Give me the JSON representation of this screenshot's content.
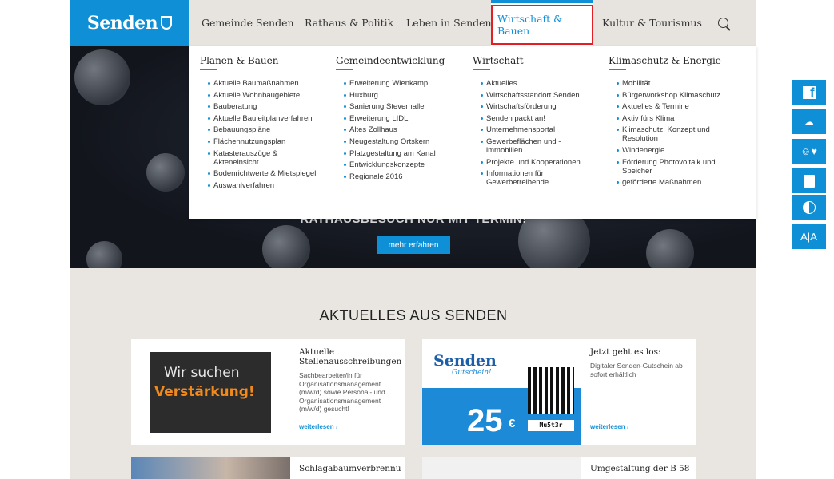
{
  "logo": {
    "text": "Senden"
  },
  "nav": {
    "items": [
      "Gemeinde Senden",
      "Rathaus & Politik",
      "Leben in Senden",
      "Wirtschaft & Bauen",
      "Kultur & Tourismus"
    ]
  },
  "hero": {
    "title": "RATHAUSBESUCH NUR MIT TERMIN!",
    "button": "mehr erfahren"
  },
  "mega": {
    "columns": [
      {
        "title": "Planen & Bauen",
        "items": [
          "Aktuelle Baumaßnahmen",
          "Aktuelle Wohnbaugebiete",
          "Bauberatung",
          "Aktuelle Bauleitplanverfahren",
          "Bebauungspläne",
          "Flächennutzungsplan",
          "Katasterauszüge & Akteneinsicht",
          "Bodenrichtwerte & Mietspiegel",
          "Auswahlverfahren"
        ]
      },
      {
        "title": "Gemeindeentwicklung",
        "items": [
          "Erweiterung Wienkamp",
          "Huxburg",
          "Sanierung Steverhalle",
          "Erweiterung LIDL",
          "Altes Zollhaus",
          "Neugestaltung Ortskern",
          "Platzgestaltung am Kanal",
          "Entwicklungskonzepte",
          "Regionale 2016"
        ]
      },
      {
        "title": "Wirtschaft",
        "items": [
          "Aktuelles",
          "Wirtschaftsstandort Senden",
          "Wirtschaftsförderung",
          "Senden packt an!",
          "Unternehmensportal",
          "Gewerbeflächen und -immobilien",
          "Projekte und Kooperationen",
          "Informationen für Gewerbetreibende"
        ]
      },
      {
        "title": "Klimaschutz & Energie",
        "items": [
          "Mobilität",
          "Bürgerworkshop Klimaschutz",
          "Aktuelles & Termine",
          "Aktiv fürs Klima",
          "Klimaschutz: Konzept und Resolution",
          "Windenergie",
          "Förderung Photovoltaik und Speicher",
          "geförderte Maßnahmen"
        ]
      }
    ]
  },
  "news": {
    "title": "AKTUELLES AUS SENDEN",
    "cards": [
      {
        "title": "Aktuelle Stellenausschreibungen",
        "text": "Sachbearbeiter/in für Organisationsmanagement (m/w/d) sowie Personal- und Organisationsmanagement (m/w/d) gesucht!",
        "more": "weiterlesen ›",
        "img1": "Wir suchen",
        "img2": "Verstärkung!"
      },
      {
        "title": "Jetzt geht es los:",
        "text": "Digitaler Senden-Gutschein ab sofort erhältlich",
        "more": "weiterlesen ›",
        "logo": "Senden",
        "sub": "Gutschein!",
        "value": "25",
        "currency": "€",
        "code": "Mu5t3r"
      },
      {
        "title": "Schlagabaumverbrennung über Ostern verboten"
      },
      {
        "title": "Umgestaltung der B 58"
      }
    ]
  },
  "side": {
    "font_size_label": "A|A"
  },
  "colors": {
    "brand": "#0f8fd6",
    "highlight": "#e31e24"
  }
}
